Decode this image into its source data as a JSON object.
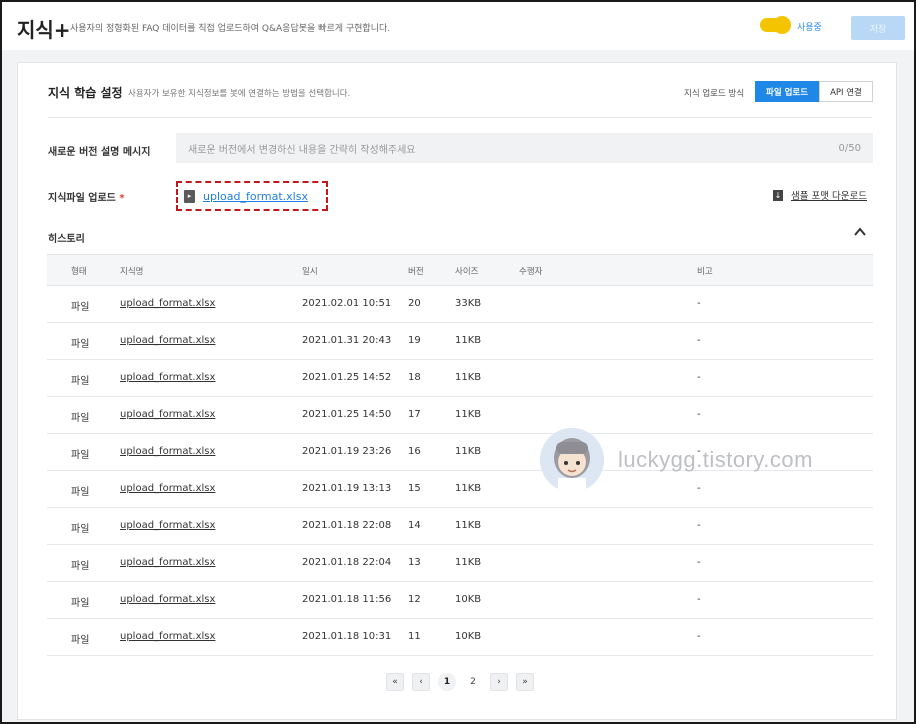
{
  "header": {
    "title": "지식+",
    "description": "사용자의 정형화된 FAQ 데이터를 직접 업로드하여 Q&A응답봇을 빠르게 구현합니다.",
    "toggle_label": "사용중",
    "toggle_state": "on",
    "save_label": "저장",
    "accent_color": "#f5c400"
  },
  "settings": {
    "title": "지식 학습 설정",
    "description": "사용자가 보유한 지식정보를 봇에 연결하는 방법을 선택합니다.",
    "upload_method_label": "지식 업로드 방식",
    "method_options": [
      "파일 업로드",
      "API 연결"
    ],
    "selected_method": "파일 업로드",
    "primary_color": "#1f87e5"
  },
  "form": {
    "message_label": "새로운 버전 설명 메시지",
    "message_placeholder": "새로운 버전에서 변경하신 내용을 간략히 작성해주세요",
    "message_counter": "0/50",
    "file_label": "지식파일 업로드",
    "required_mark": "*",
    "file_name": "upload_format.xlsx",
    "sample_download_label": "샘플 포맷 다운로드"
  },
  "history": {
    "title": "히스토리",
    "columns": [
      "형태",
      "지식명",
      "일시",
      "버전",
      "사이즈",
      "수행자",
      "비고"
    ],
    "rows": [
      {
        "type": "파일",
        "name": "upload_format.xlsx",
        "date": "2021.02.01 10:51",
        "version": "20",
        "size": "33KB",
        "user": "",
        "note": "-"
      },
      {
        "type": "파일",
        "name": "upload_format.xlsx",
        "date": "2021.01.31 20:43",
        "version": "19",
        "size": "11KB",
        "user": "",
        "note": "-"
      },
      {
        "type": "파일",
        "name": "upload_format.xlsx",
        "date": "2021.01.25 14:52",
        "version": "18",
        "size": "11KB",
        "user": "",
        "note": "-"
      },
      {
        "type": "파일",
        "name": "upload_format.xlsx",
        "date": "2021.01.25 14:50",
        "version": "17",
        "size": "11KB",
        "user": "",
        "note": "-"
      },
      {
        "type": "파일",
        "name": "upload_format.xlsx",
        "date": "2021.01.19 23:26",
        "version": "16",
        "size": "11KB",
        "user": "",
        "note": "-"
      },
      {
        "type": "파일",
        "name": "upload_format.xlsx",
        "date": "2021.01.19 13:13",
        "version": "15",
        "size": "11KB",
        "user": "",
        "note": "-"
      },
      {
        "type": "파일",
        "name": "upload_format.xlsx",
        "date": "2021.01.18 22:08",
        "version": "14",
        "size": "11KB",
        "user": "",
        "note": "-"
      },
      {
        "type": "파일",
        "name": "upload_format.xlsx",
        "date": "2021.01.18 22:04",
        "version": "13",
        "size": "11KB",
        "user": "",
        "note": "-"
      },
      {
        "type": "파일",
        "name": "upload_format.xlsx",
        "date": "2021.01.18 11:56",
        "version": "12",
        "size": "10KB",
        "user": "",
        "note": "-"
      },
      {
        "type": "파일",
        "name": "upload_format.xlsx",
        "date": "2021.01.18 10:31",
        "version": "11",
        "size": "10KB",
        "user": "",
        "note": "-"
      }
    ]
  },
  "pagination": {
    "first": "«",
    "prev": "‹",
    "pages": [
      "1",
      "2"
    ],
    "current": "1",
    "next": "›",
    "last": "»"
  },
  "watermark": {
    "text": "luckygg.tistory.com"
  }
}
